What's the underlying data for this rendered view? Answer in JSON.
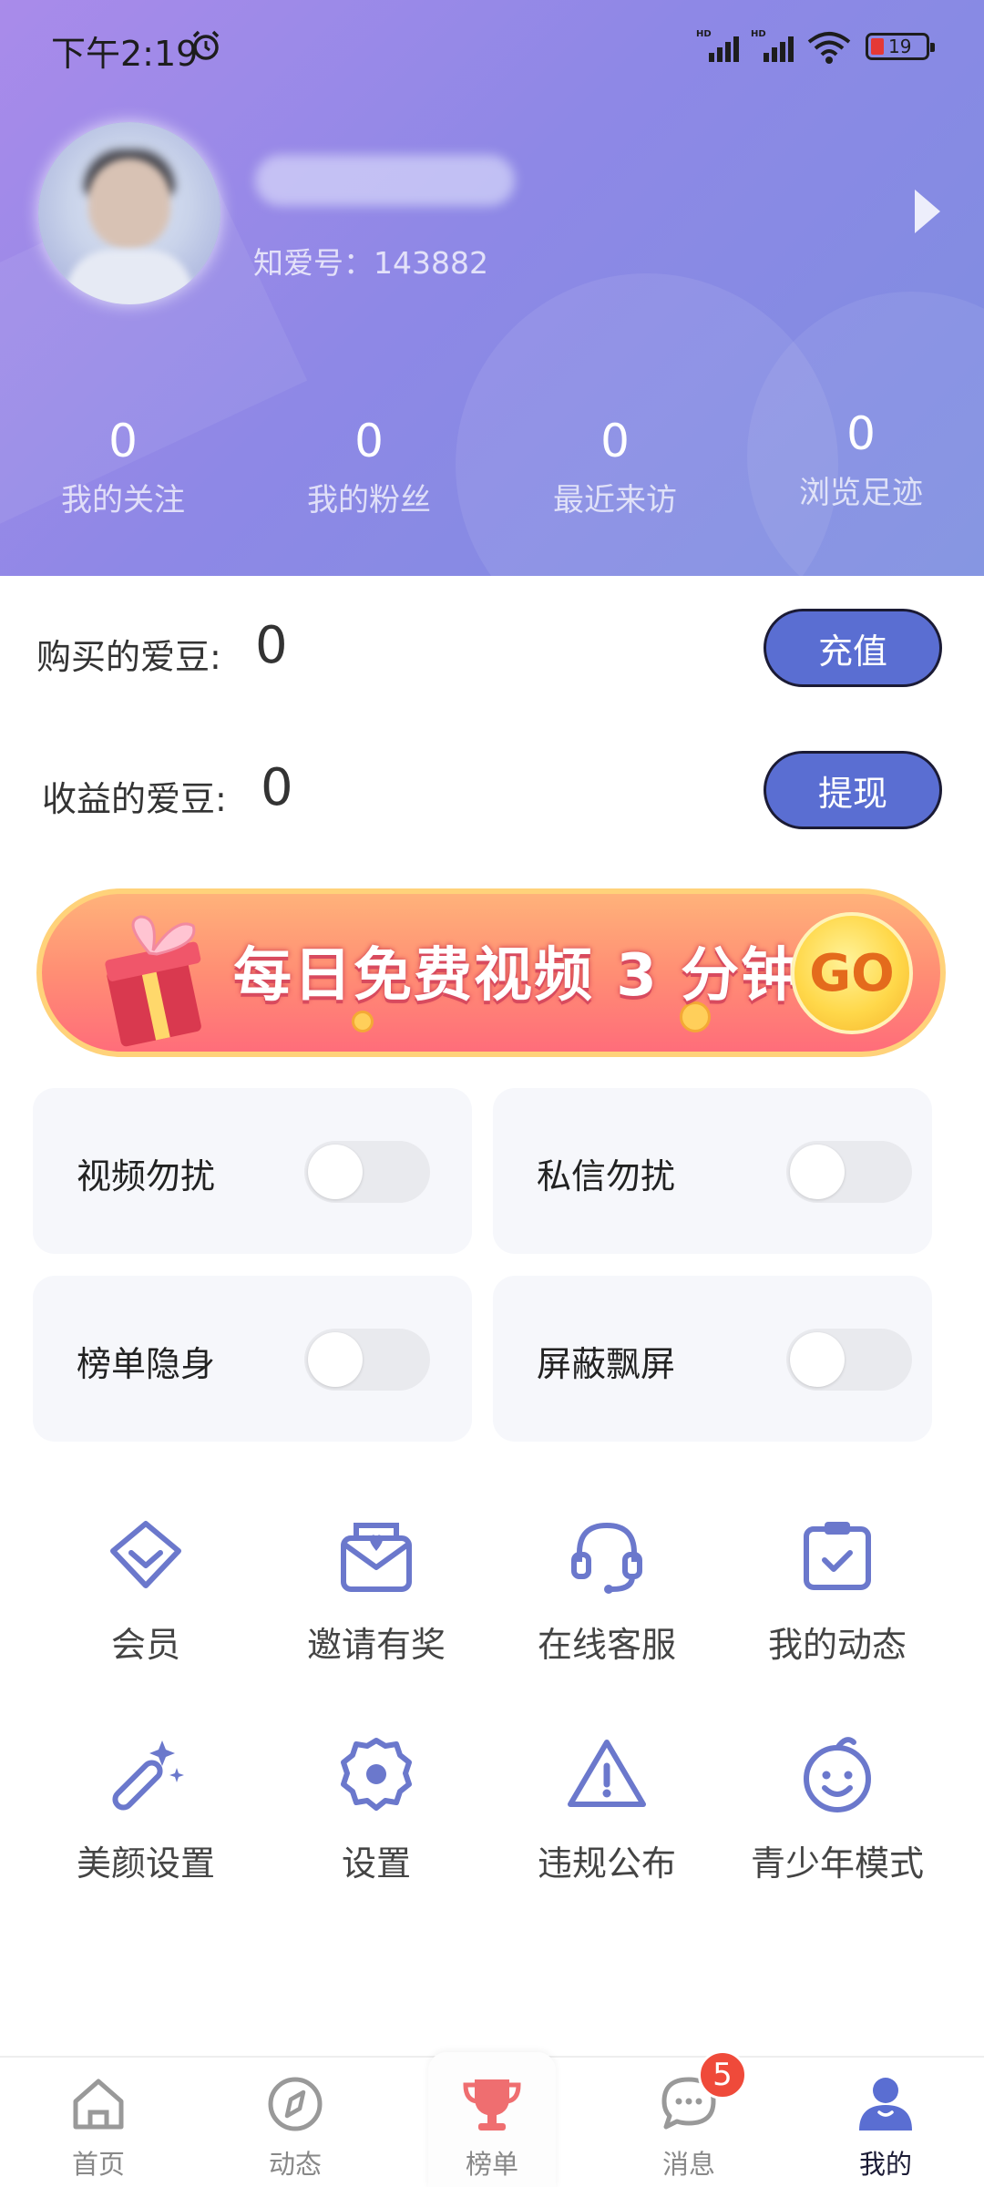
{
  "status_bar": {
    "time": "下午2:19",
    "signal1": "HD",
    "signal2": "HD",
    "battery": "19"
  },
  "profile": {
    "user_id": "知爱号：143882"
  },
  "stats": [
    {
      "value": "0",
      "label": "我的关注"
    },
    {
      "value": "0",
      "label": "我的粉丝"
    },
    {
      "value": "0",
      "label": "最近来访"
    },
    {
      "value": "0",
      "label": "浏览足迹"
    }
  ],
  "balances": {
    "purchased_label": "购买的爱豆:",
    "purchased_value": "0",
    "recharge_label": "充值",
    "earned_label": "收益的爱豆:",
    "earned_value": "0",
    "withdraw_label": "提现"
  },
  "banner": {
    "text": "每日免费视频 3 分钟",
    "go": "GO"
  },
  "toggles": [
    {
      "label": "视频勿扰",
      "on": false
    },
    {
      "label": "私信勿扰",
      "on": false
    },
    {
      "label": "榜单隐身",
      "on": false
    },
    {
      "label": "屏蔽飘屏",
      "on": false
    }
  ],
  "grid": [
    {
      "label": "会员",
      "icon": "diamond-icon"
    },
    {
      "label": "邀请有奖",
      "icon": "envelope-heart-icon"
    },
    {
      "label": "在线客服",
      "icon": "headset-icon"
    },
    {
      "label": "我的动态",
      "icon": "clipboard-check-icon"
    },
    {
      "label": "美颜设置",
      "icon": "magic-wand-icon"
    },
    {
      "label": "设置",
      "icon": "gear-icon"
    },
    {
      "label": "违规公布",
      "icon": "warning-icon"
    },
    {
      "label": "青少年模式",
      "icon": "baby-face-icon"
    }
  ],
  "tabs": [
    {
      "label": "首页",
      "icon": "home-icon"
    },
    {
      "label": "动态",
      "icon": "compass-icon"
    },
    {
      "label": "榜单",
      "icon": "trophy-icon"
    },
    {
      "label": "消息",
      "icon": "chat-icon",
      "badge": "5"
    },
    {
      "label": "我的",
      "icon": "person-icon",
      "active": true
    }
  ],
  "colors": {
    "accent": "#5a6ed2",
    "icon": "#6b78cc",
    "badge": "#ef4a3a"
  }
}
